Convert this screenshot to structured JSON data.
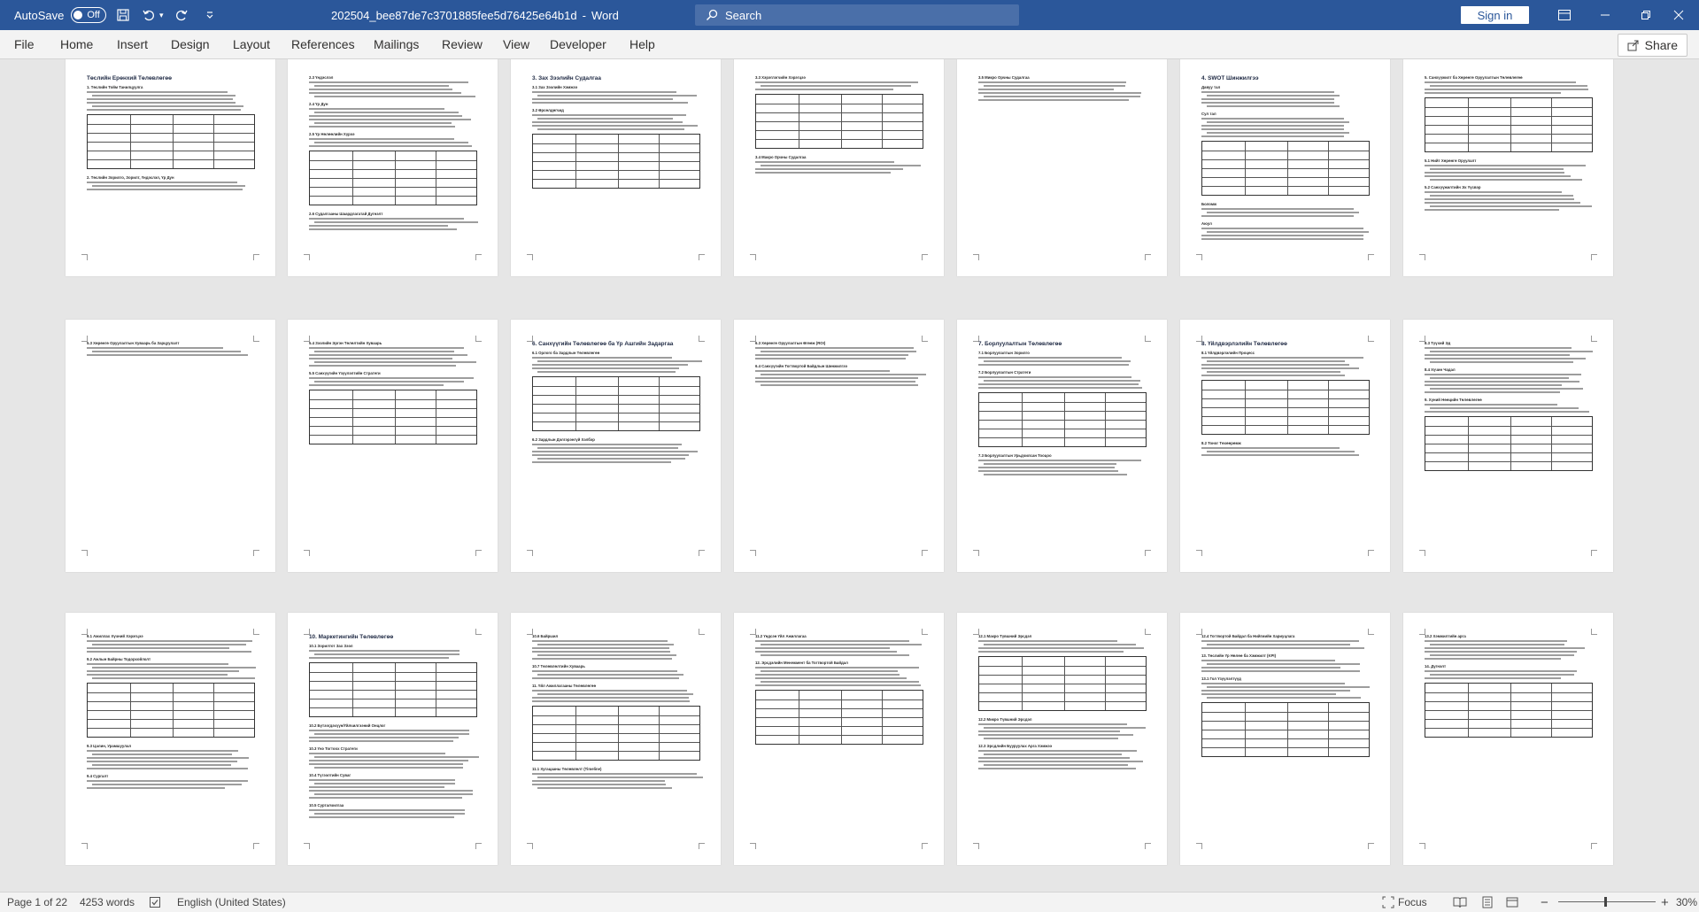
{
  "titlebar": {
    "autosave_label": "AutoSave",
    "autosave_state": "Off",
    "doc_title": "202504_bee87de7c3701885fee5d76425e64b1d",
    "app_name": "Word",
    "search_placeholder": "Search",
    "signin_label": "Sign in"
  },
  "ribbon": {
    "tabs": [
      "File",
      "Home",
      "Insert",
      "Design",
      "Layout",
      "References",
      "Mailings",
      "Review",
      "View",
      "Developer",
      "Help"
    ],
    "share_label": "Share"
  },
  "pages": [
    {
      "heading": "Төслийн Ерөнхий Төлөвлөгөө",
      "subs": [
        "1. Төслийн Тойм Танилцуулга",
        "2. Төслийн Зорилго, Зорилт, Үндэслэл, Үр Дүн"
      ]
    },
    {
      "heading": "",
      "subs": [
        "2.3 Үндэслэл",
        "2.4 Үр Дүн",
        "2.5 Үр Нөлөөлийн Хүрээ",
        "2.6 Судалгааны Шаардлагатай Дүгнэлт"
      ]
    },
    {
      "heading": "3. Зах Зээлийн Судалгаа",
      "subs": [
        "3.1 Зах Зээлийн Хэмжээ",
        "3.2 Өрсөлдөгчид"
      ]
    },
    {
      "heading": "",
      "subs": [
        "3.3 Хэрэглэгчийн Хэрэгцээ",
        "3.4 Макро Орчны Судалгаа"
      ]
    },
    {
      "heading": "",
      "subs": [
        "3.5 Микро Орчны Судалгаа"
      ]
    },
    {
      "heading": "4. SWOT Шинжилгээ",
      "subs": [
        "Давуу тал",
        "Сул тал",
        "Боломж",
        "Аюул"
      ]
    },
    {
      "heading": "",
      "subs": [
        "5. Санхүүжилт ба Хөрөнгө Оруулалтын Төлөвлөгөө",
        "5.1 Нийт Хөрөнгө Оруулалт",
        "5.2 Санхүүжилтийн Эх Үүсвэр"
      ]
    },
    {
      "heading": "",
      "subs": [
        "5.3 Хөрөнгө Оруулалтын Хуваарь ба Зарцуулалт"
      ]
    },
    {
      "heading": "",
      "subs": [
        "5.4 Зээлийн Эргэн Төлөлтийн Хуваарь",
        "5.5 Санхүүгийн Үзүүлэлтийн Стратеги"
      ]
    },
    {
      "heading": "6. Санхүүгийн Төлөвлөгөө ба Үр Ашгийн Задаргаа",
      "subs": [
        "6.1 Орлого ба Зардлын Төлөвлөгөө",
        "6.2 Зардлын Дэлгэрэнгүй Хэлбэр"
      ]
    },
    {
      "heading": "",
      "subs": [
        "6.3 Хөрөнгө Оруулалтын Өгөөж (ROI)",
        "6.4 Санхүүгийн Тогтвортой Байдлын Шинжилгээ"
      ]
    },
    {
      "heading": "7. Борлуулалтын Төлөвлөгөө",
      "subs": [
        "7.1 Борлуулалтын Зорилго",
        "7.2 Борлуулалтын Стратеги",
        "7.3 Борлуулалтын Урьдчилсан Тооцоо"
      ]
    },
    {
      "heading": "8. Үйлдвэрлэлийн Төлөвлөгөө",
      "subs": [
        "8.1 Үйлдвэрлэлийн Процесс",
        "8.2 Тоног Төхөөрөмж"
      ]
    },
    {
      "heading": "",
      "subs": [
        "8.3 Түүхий Эд",
        "8.4 Хүчин Чадал",
        "9. Хүний Нөөцийн Төлөвлөгөө"
      ]
    },
    {
      "heading": "",
      "subs": [
        "9.1 Ажиллах Хүчний Хэрэгцээ",
        "9.2 Ажлын Байрны Тодорхойлолт",
        "9.3 Цалин, Урамшуулал",
        "9.4 Сургалт"
      ]
    },
    {
      "heading": "10. Маркетингийн Төлөвлөгөө",
      "subs": [
        "10.1 Зорилтот Зах Зээл",
        "10.2 Бүтээгдэхүүн/Үйлчилгээний Онцлог",
        "10.3 Үнэ Тогтоох Стратеги",
        "10.4 Түгээлтийн Суваг",
        "10.5 Сурталчилгаа"
      ]
    },
    {
      "heading": "",
      "subs": [
        "10.6 Байршил",
        "10.7 Төлөвлөлтийн Хуваарь",
        "11. Үйл Ажиллагааны Төлөвлөгөө",
        "11.1 Хугацааны Төлөвлөлт (Timeline)"
      ]
    },
    {
      "heading": "",
      "subs": [
        "11.2 Үндсэн Үйл Ажиллагаа",
        "12. Эрсдэлийн Менежмент ба Тогтвортой Байдал"
      ]
    },
    {
      "heading": "",
      "subs": [
        "12.1 Макро Түвшний Эрсдэл",
        "12.2 Микро Түвшний Эрсдэл",
        "12.3 Эрсдлийн Бууруулах Арга Хэмжээ"
      ]
    },
    {
      "heading": "",
      "subs": [
        "12.4 Тогтвортой Байдал ба Нийгмийн Хариуцлага",
        "13. Төслийн Үр Нөлөө ба Хэмжилт (KPI)",
        "13.1 Гол Үзүүлэлтүүд"
      ]
    },
    {
      "heading": "",
      "subs": [
        "13.2 Хэмжилтийн арга",
        "14. Дүгнэлт"
      ]
    }
  ],
  "statusbar": {
    "page_info": "Page 1 of 22",
    "word_count": "4253 words",
    "language": "English (United States)",
    "focus_label": "Focus",
    "zoom_level": "30%"
  }
}
